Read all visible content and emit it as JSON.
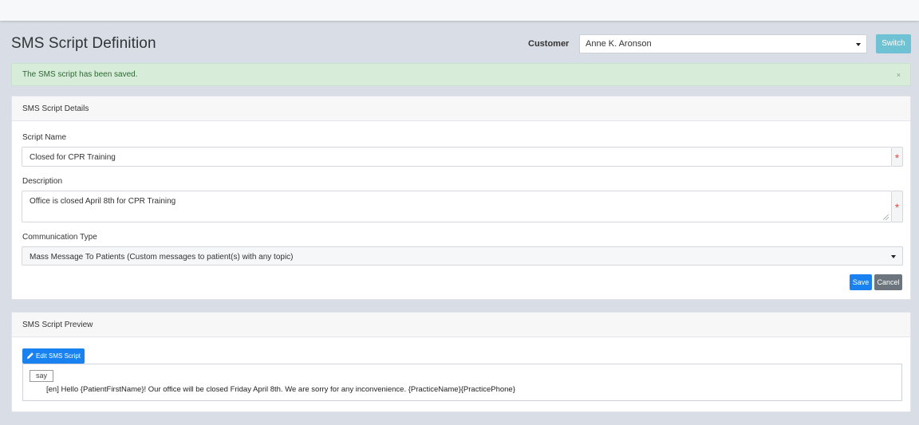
{
  "header": {
    "title": "SMS Script Definition",
    "customer_label": "Customer",
    "customer_selected": "Anne K. Aronson",
    "switch_label": "Switch"
  },
  "alert": {
    "message": "The SMS script has been saved.",
    "close": "×"
  },
  "details": {
    "header": "SMS Script Details",
    "script_name_label": "Script Name",
    "script_name_value": "Closed for CPR Training",
    "description_label": "Description",
    "description_value": "Office is closed April 8th for CPR Training",
    "comm_type_label": "Communication Type",
    "comm_type_value": "Mass Message To Patients (Custom messages to patient(s) with any topic)",
    "required_marker": "*",
    "save_label": "Save",
    "cancel_label": "Cancel"
  },
  "preview": {
    "header": "SMS Script Preview",
    "edit_label": "Edit SMS Script",
    "say_tag": "say",
    "text": "[en] Hello {PatientFirstName}! Our office will be closed Friday April 8th. We are sorry for any inconvenience. {PracticeName}{PracticePhone}"
  },
  "colors": {
    "background": "#d9dee6",
    "primary": "#1a82f0",
    "info": "#6ec2d4",
    "success_bg": "#d7ecd9",
    "danger": "#d9534f",
    "secondary": "#6c757d"
  }
}
